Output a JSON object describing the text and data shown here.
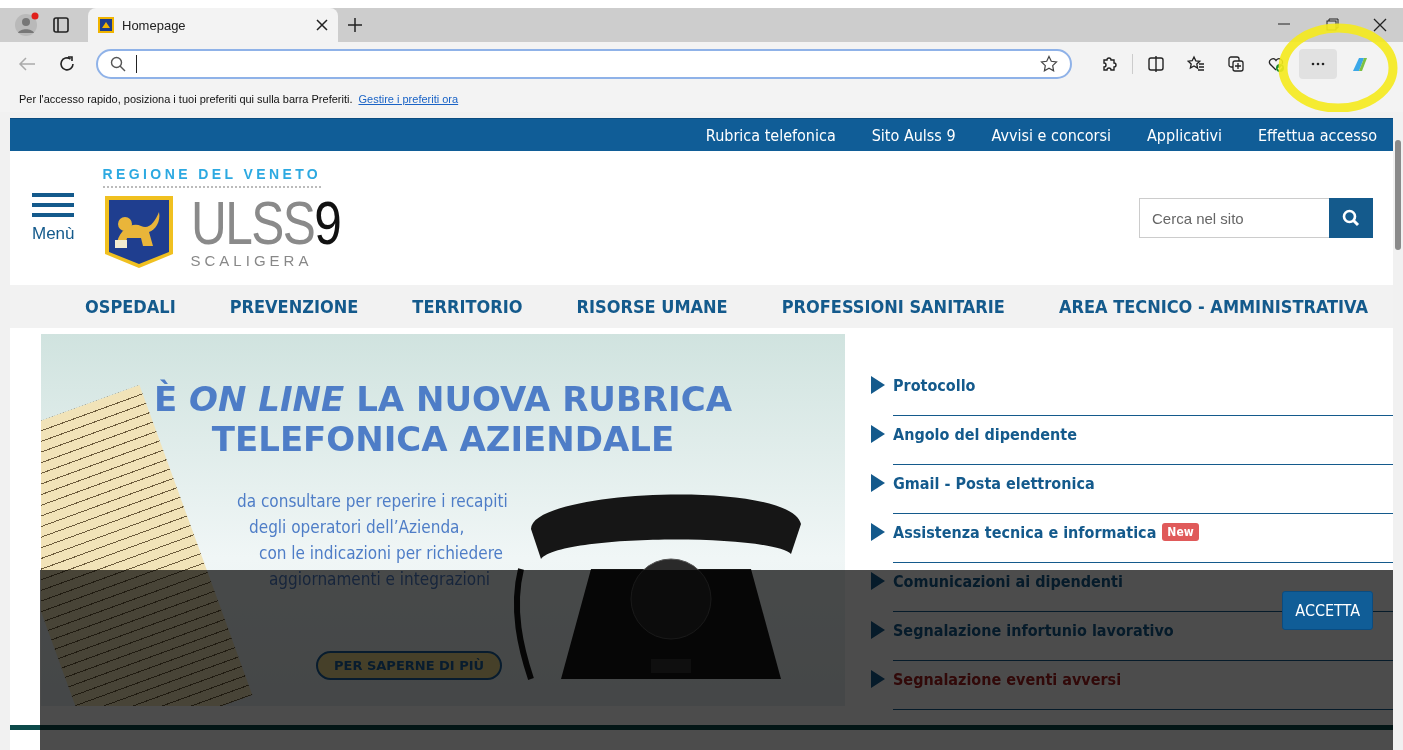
{
  "browser": {
    "tab": {
      "title": "Homepage",
      "selected": true
    },
    "favorites_hint": "Per l'accesso rapido, posiziona i tuoi preferiti qui sulla barra Preferiti.",
    "favorites_link": "Gestire i preferiti ora"
  },
  "top_links": [
    "Rubrica telefonica",
    "Sito Aulss 9",
    "Avvisi e concorsi",
    "Applicativi",
    "Effettua accesso"
  ],
  "menu_label": "Menù",
  "logo": {
    "region": "REGIONE DEL VENETO",
    "name": "ULSS",
    "number": "9",
    "subtitle": "SCALIGERA"
  },
  "search": {
    "placeholder": "Cerca nel sito"
  },
  "nav": [
    "OSPEDALI",
    "PREVENZIONE",
    "TERRITORIO",
    "RISORSE UMANE",
    "PROFESSIONI SANITARIE",
    "AREA TECNICO - AMMINISTRATIVA"
  ],
  "banner": {
    "title_lines": [
      "È *ON LINE* LA NUOVA RUBRICA",
      "TELEFONICA AZIENDALE"
    ],
    "body_lines": [
      "da consultare per reperire i recapiti",
      "degli operatori dell’Azienda,",
      "con le indicazioni per richiedere",
      "aggiornamenti e integrazioni"
    ],
    "button": "PER SAPERNE DI PIÙ"
  },
  "quick_links": [
    {
      "label": "Protocollo",
      "kind": "link"
    },
    {
      "label": "Angolo del dipendente",
      "kind": "link"
    },
    {
      "label": "Gmail - Posta elettronica",
      "kind": "link"
    },
    {
      "label": "Assistenza tecnica e informatica",
      "kind": "link",
      "badge": "New"
    },
    {
      "label": "Comunicazioni ai dipendenti",
      "kind": "link"
    },
    {
      "label": "Segnalazione infortunio lavorativo",
      "kind": "link"
    },
    {
      "label": "Segnalazione eventi avversi",
      "kind": "alert"
    }
  ],
  "cookie": {
    "button": "ACCETTA"
  }
}
